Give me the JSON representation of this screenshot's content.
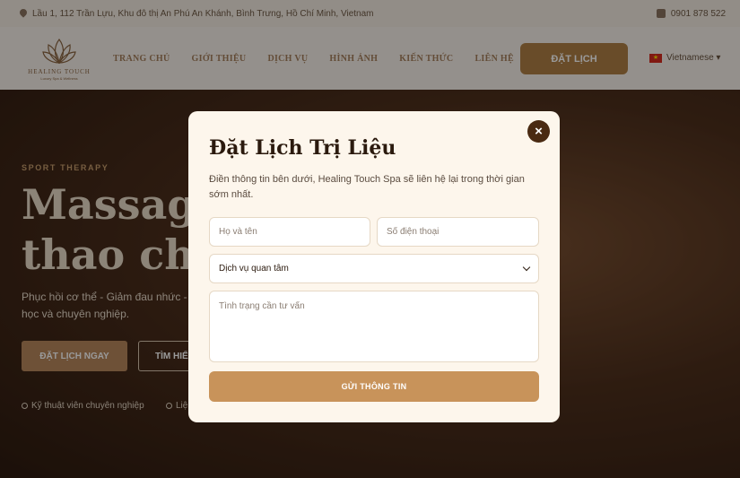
{
  "topbar": {
    "address": "Lầu 1, 112 Trần Lựu, Khu đô thị An Phú An Khánh, Bình Trưng, Hồ Chí Minh, Vietnam",
    "phone": "0901 878 522"
  },
  "header": {
    "logo_brand": "HEALING TOUCH",
    "logo_tagline": "Luxury Spa & Wellness",
    "nav": [
      "TRANG CHỦ",
      "GIỚI THIỆU",
      "DỊCH VỤ",
      "HÌNH ẢNH",
      "KIẾN THỨC",
      "LIÊN HỆ"
    ],
    "book_label": "ĐẶT LỊCH",
    "language": "Vietnamese ▾"
  },
  "hero": {
    "subtitle": "SPORT THERAPY",
    "title_line1": "Massage",
    "title_line2": "thao chu",
    "description": "Phục hồi cơ thể - Giảm đau nhức - trị liệu khoa học và chuyên nghiệp.",
    "primary_button": "ĐẶT LỊCH NGAY",
    "secondary_button": "TÌM HIỂ",
    "features": [
      "Kỹ thuật viên chuyên nghiệp",
      "Liệ"
    ]
  },
  "modal": {
    "title": "Đặt Lịch Trị Liệu",
    "lead": "Điền thông tin bên dưới, Healing Touch Spa sẽ liên hệ lại trong thời gian sớm nhất.",
    "name_placeholder": "Họ và tên",
    "phone_placeholder": "Số điện thoại",
    "service_selected": "Dịch vụ quan tâm",
    "note_placeholder": "Tình trạng cần tư vấn",
    "submit_label": "GỬI THÔNG TIN",
    "close_glyph": "×"
  },
  "colors": {
    "accent": "#c8935a",
    "close_button": "#4a2a12",
    "modal_bg": "#fdf6ec"
  }
}
